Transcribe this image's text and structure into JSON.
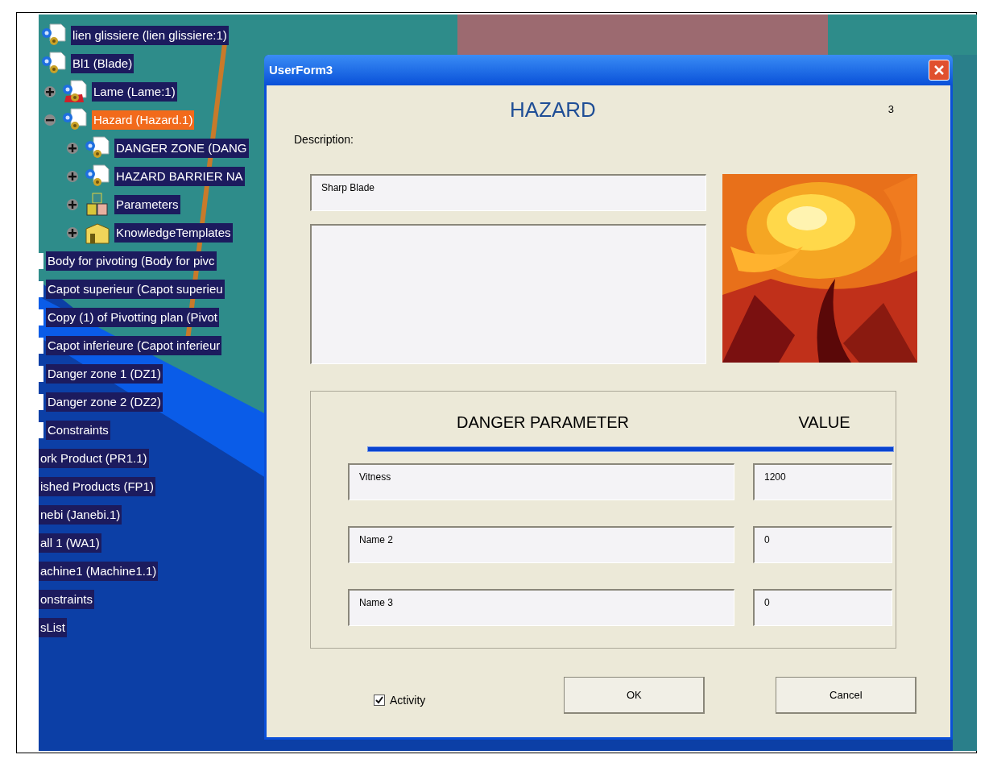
{
  "tree": [
    {
      "label": "lien glissiere (lien glissiere:1)",
      "kind": "product",
      "selected": false
    },
    {
      "label": "Bl1 (Blade)",
      "kind": "product",
      "selected": false,
      "children": [
        {
          "label": "Lame (Lame:1)",
          "kind": "part",
          "expanded": false,
          "selected": false
        },
        {
          "label": "Hazard (Hazard.1)",
          "kind": "product",
          "expanded": true,
          "selected": true,
          "children": [
            {
              "label": "DANGER ZONE (DANG",
              "kind": "product",
              "expanded": false,
              "selected": false
            },
            {
              "label": "HAZARD BARRIER NA",
              "kind": "product",
              "expanded": false,
              "selected": false
            },
            {
              "label": "Parameters",
              "kind": "parameters",
              "expanded": false,
              "selected": false
            },
            {
              "label": "KnowledgeTemplates",
              "kind": "knowledge",
              "expanded": false,
              "selected": false
            }
          ]
        }
      ]
    },
    {
      "label": "Body for pivoting (Body for pivc",
      "kind": "stub",
      "selected": false
    },
    {
      "label": "Capot superieur (Capot superieu",
      "kind": "stub",
      "selected": false
    },
    {
      "label": "Copy (1) of Pivotting plan (Pivot",
      "kind": "stub",
      "selected": false
    },
    {
      "label": "Capot inferieure (Capot inferieur",
      "kind": "stub",
      "selected": false
    },
    {
      "label": "Danger zone 1 (DZ1)",
      "kind": "stub",
      "selected": false
    },
    {
      "label": "Danger zone 2 (DZ2)",
      "kind": "stub",
      "selected": false
    },
    {
      "label": "Constraints",
      "kind": "stub",
      "selected": false
    },
    {
      "label": "ork Product (PR1.1)",
      "kind": "clipped",
      "selected": false
    },
    {
      "label": "ished Products (FP1)",
      "kind": "clipped",
      "selected": false
    },
    {
      "label": "nebi (Janebi.1)",
      "kind": "clipped",
      "selected": false
    },
    {
      "label": "all 1 (WA1)",
      "kind": "clipped",
      "selected": false
    },
    {
      "label": "achine1 (Machine1.1)",
      "kind": "clipped",
      "selected": false
    },
    {
      "label": "onstraints",
      "kind": "clipped",
      "selected": false
    },
    {
      "label": "sList",
      "kind": "clipped",
      "selected": false
    }
  ],
  "dialog": {
    "title": "UserForm3",
    "heading": "HAZARD",
    "counter": "3",
    "description_label": "Description:",
    "description": {
      "value": "Sharp Blade"
    },
    "image": {
      "kind": "picture"
    },
    "columns": [
      "DANGER PARAMETER",
      "VALUE"
    ],
    "parameters": [
      {
        "name": "Vitness",
        "value": "1200"
      },
      {
        "name": "Name 2",
        "value": "0"
      },
      {
        "name": "Name 3",
        "value": "0"
      }
    ],
    "activity": {
      "label": "Activity",
      "checked": true
    },
    "buttons": [
      "OK",
      "Cancel"
    ]
  }
}
